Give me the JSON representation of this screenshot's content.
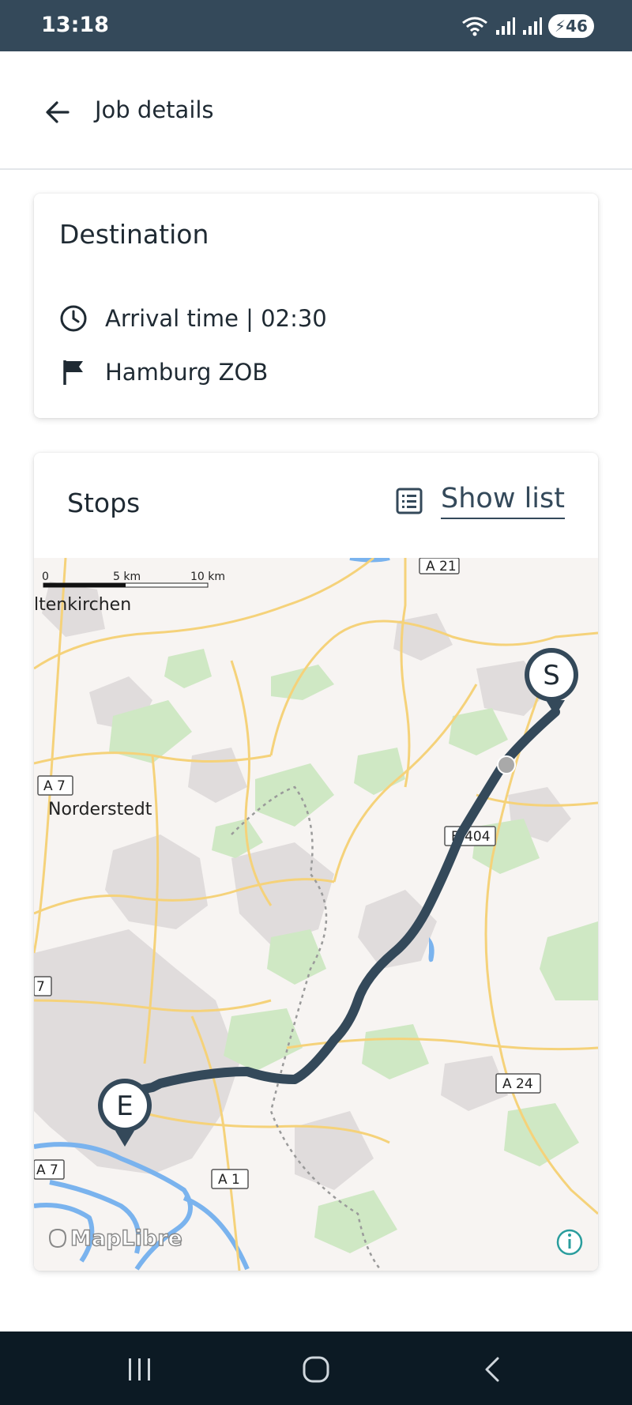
{
  "status_bar": {
    "time": "13:18",
    "battery": "46"
  },
  "header": {
    "title": "Job details"
  },
  "destination": {
    "title": "Destination",
    "arrival": "Arrival time | 02:30",
    "location": "Hamburg ZOB"
  },
  "stops": {
    "title": "Stops",
    "show_list_label": "Show list"
  },
  "map": {
    "scale": {
      "zero": "0",
      "mid": "5 km",
      "end": "10 km"
    },
    "place_labels": [
      "ltenkirchen",
      "Norderstedt"
    ],
    "road_labels": [
      "A 21",
      "A 7",
      "B 404",
      "7",
      "A 24",
      "A 7",
      "A 1"
    ],
    "start_marker": "S",
    "end_marker": "E",
    "attribution": "MapLibre",
    "colors": {
      "route": "#34495a",
      "land": "#f7f4f2",
      "green": "#cfe8c4",
      "water": "#7ab3ee",
      "road": "#f5d27a",
      "urban": "#e0dcdc"
    }
  },
  "colors": {
    "primary": "#34495a",
    "nav": "#0c1a24"
  }
}
